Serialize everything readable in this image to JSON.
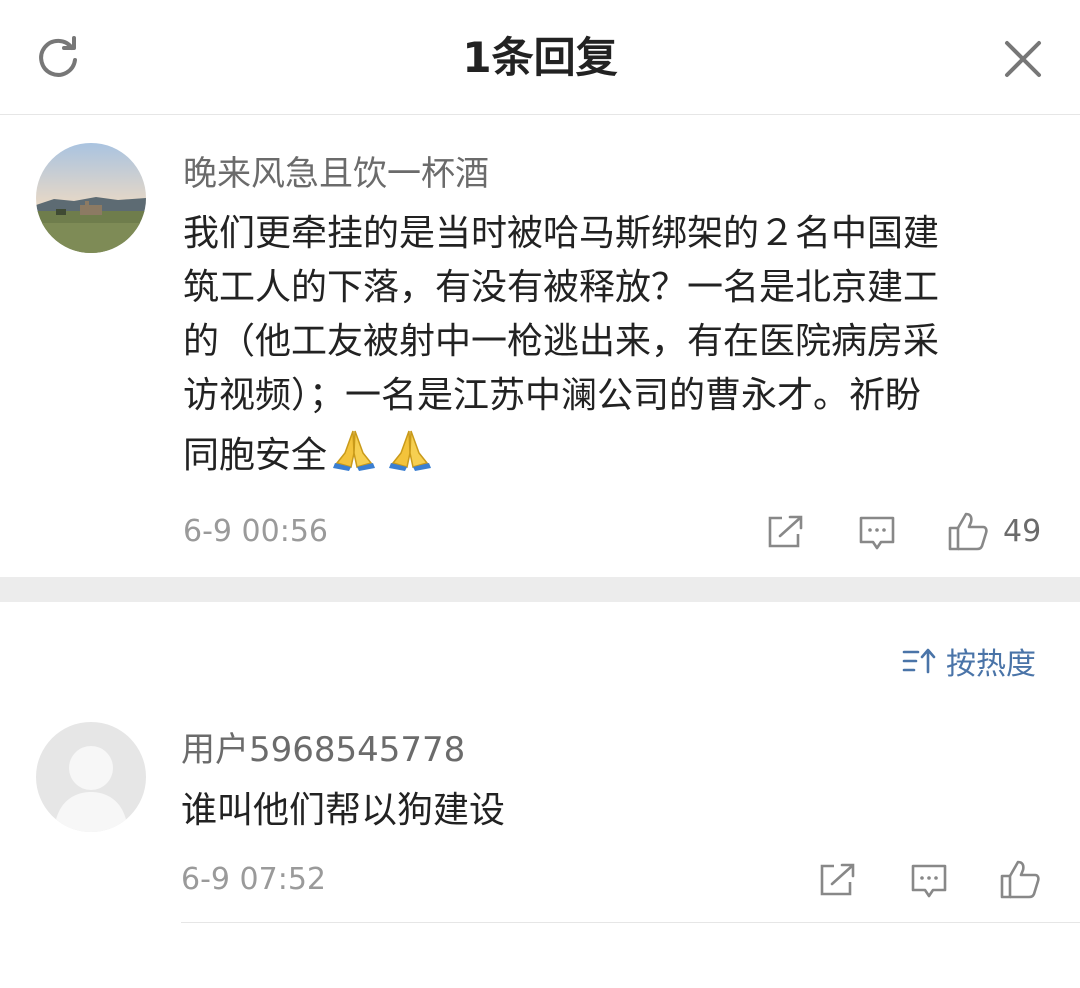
{
  "header": {
    "title": "1条回复",
    "refresh_icon": "refresh-icon",
    "close_icon": "close-icon"
  },
  "main_comment": {
    "username": "晚来风急且饮一杯酒",
    "text_lines": [
      "我们更牵挂的是当时被哈马斯绑架的２名中国建",
      "筑工人的下落，有没有被释放？一名是北京建工",
      "的（他工友被射中一枪逃出来，有在医院病房采",
      "访视频）；一名是江苏中澜公司的曹永才。祈盼",
      "同胞安全"
    ],
    "emojis": [
      "folded-hands-emoji",
      "folded-hands-emoji"
    ],
    "timestamp": "6-9 00:56",
    "like_count": "49",
    "actions": [
      "share-icon",
      "comment-icon",
      "like-icon"
    ]
  },
  "sort": {
    "label": "按热度",
    "icon": "sort-icon"
  },
  "replies": [
    {
      "username": "用户5968545778",
      "text": "谁叫他们帮以狗建设",
      "timestamp": "6-9 07:52",
      "avatar": "default-avatar-icon",
      "actions": [
        "share-icon",
        "comment-icon",
        "like-icon"
      ]
    }
  ],
  "colors": {
    "title": "#222222",
    "username": "#6b6b6b",
    "meta": "#9a9a9a",
    "accent": "#4a74a8",
    "divider_band": "#ececec"
  }
}
